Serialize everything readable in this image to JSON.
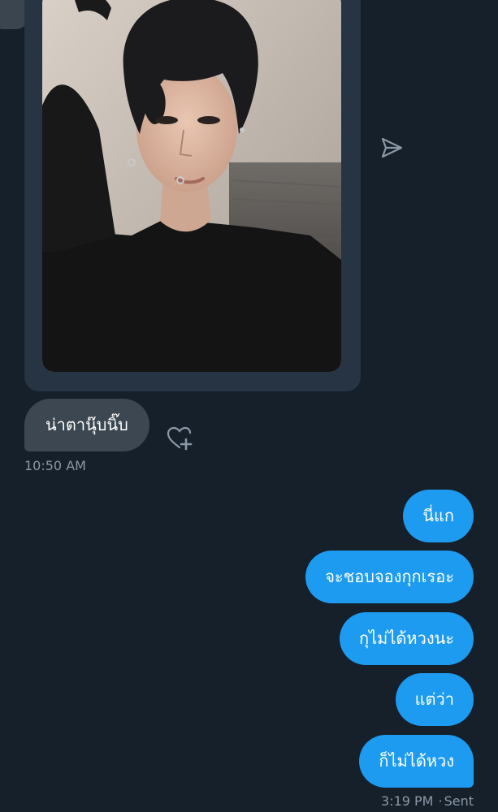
{
  "conversation": {
    "incoming": {
      "message": "น่าตานุ๊บนิ๊บ",
      "time": "10:50 AM"
    },
    "outgoing": {
      "messages": [
        "นี่แก",
        "จะชอบจองกุกเรอะ",
        "กุไม่ได้หวงนะ",
        "แต่ว่า",
        "ก็ไม่ได้หวง"
      ],
      "time": "3:19 PM",
      "status": "Sent"
    }
  },
  "icons": {
    "share": "share-icon",
    "react": "heart-plus-icon"
  },
  "colors": {
    "background": "#15202b",
    "outgoing_bubble": "#1d9bf0",
    "incoming_bubble": "#3c4751",
    "media_card": "#263443",
    "muted_text": "#8b98a5"
  }
}
